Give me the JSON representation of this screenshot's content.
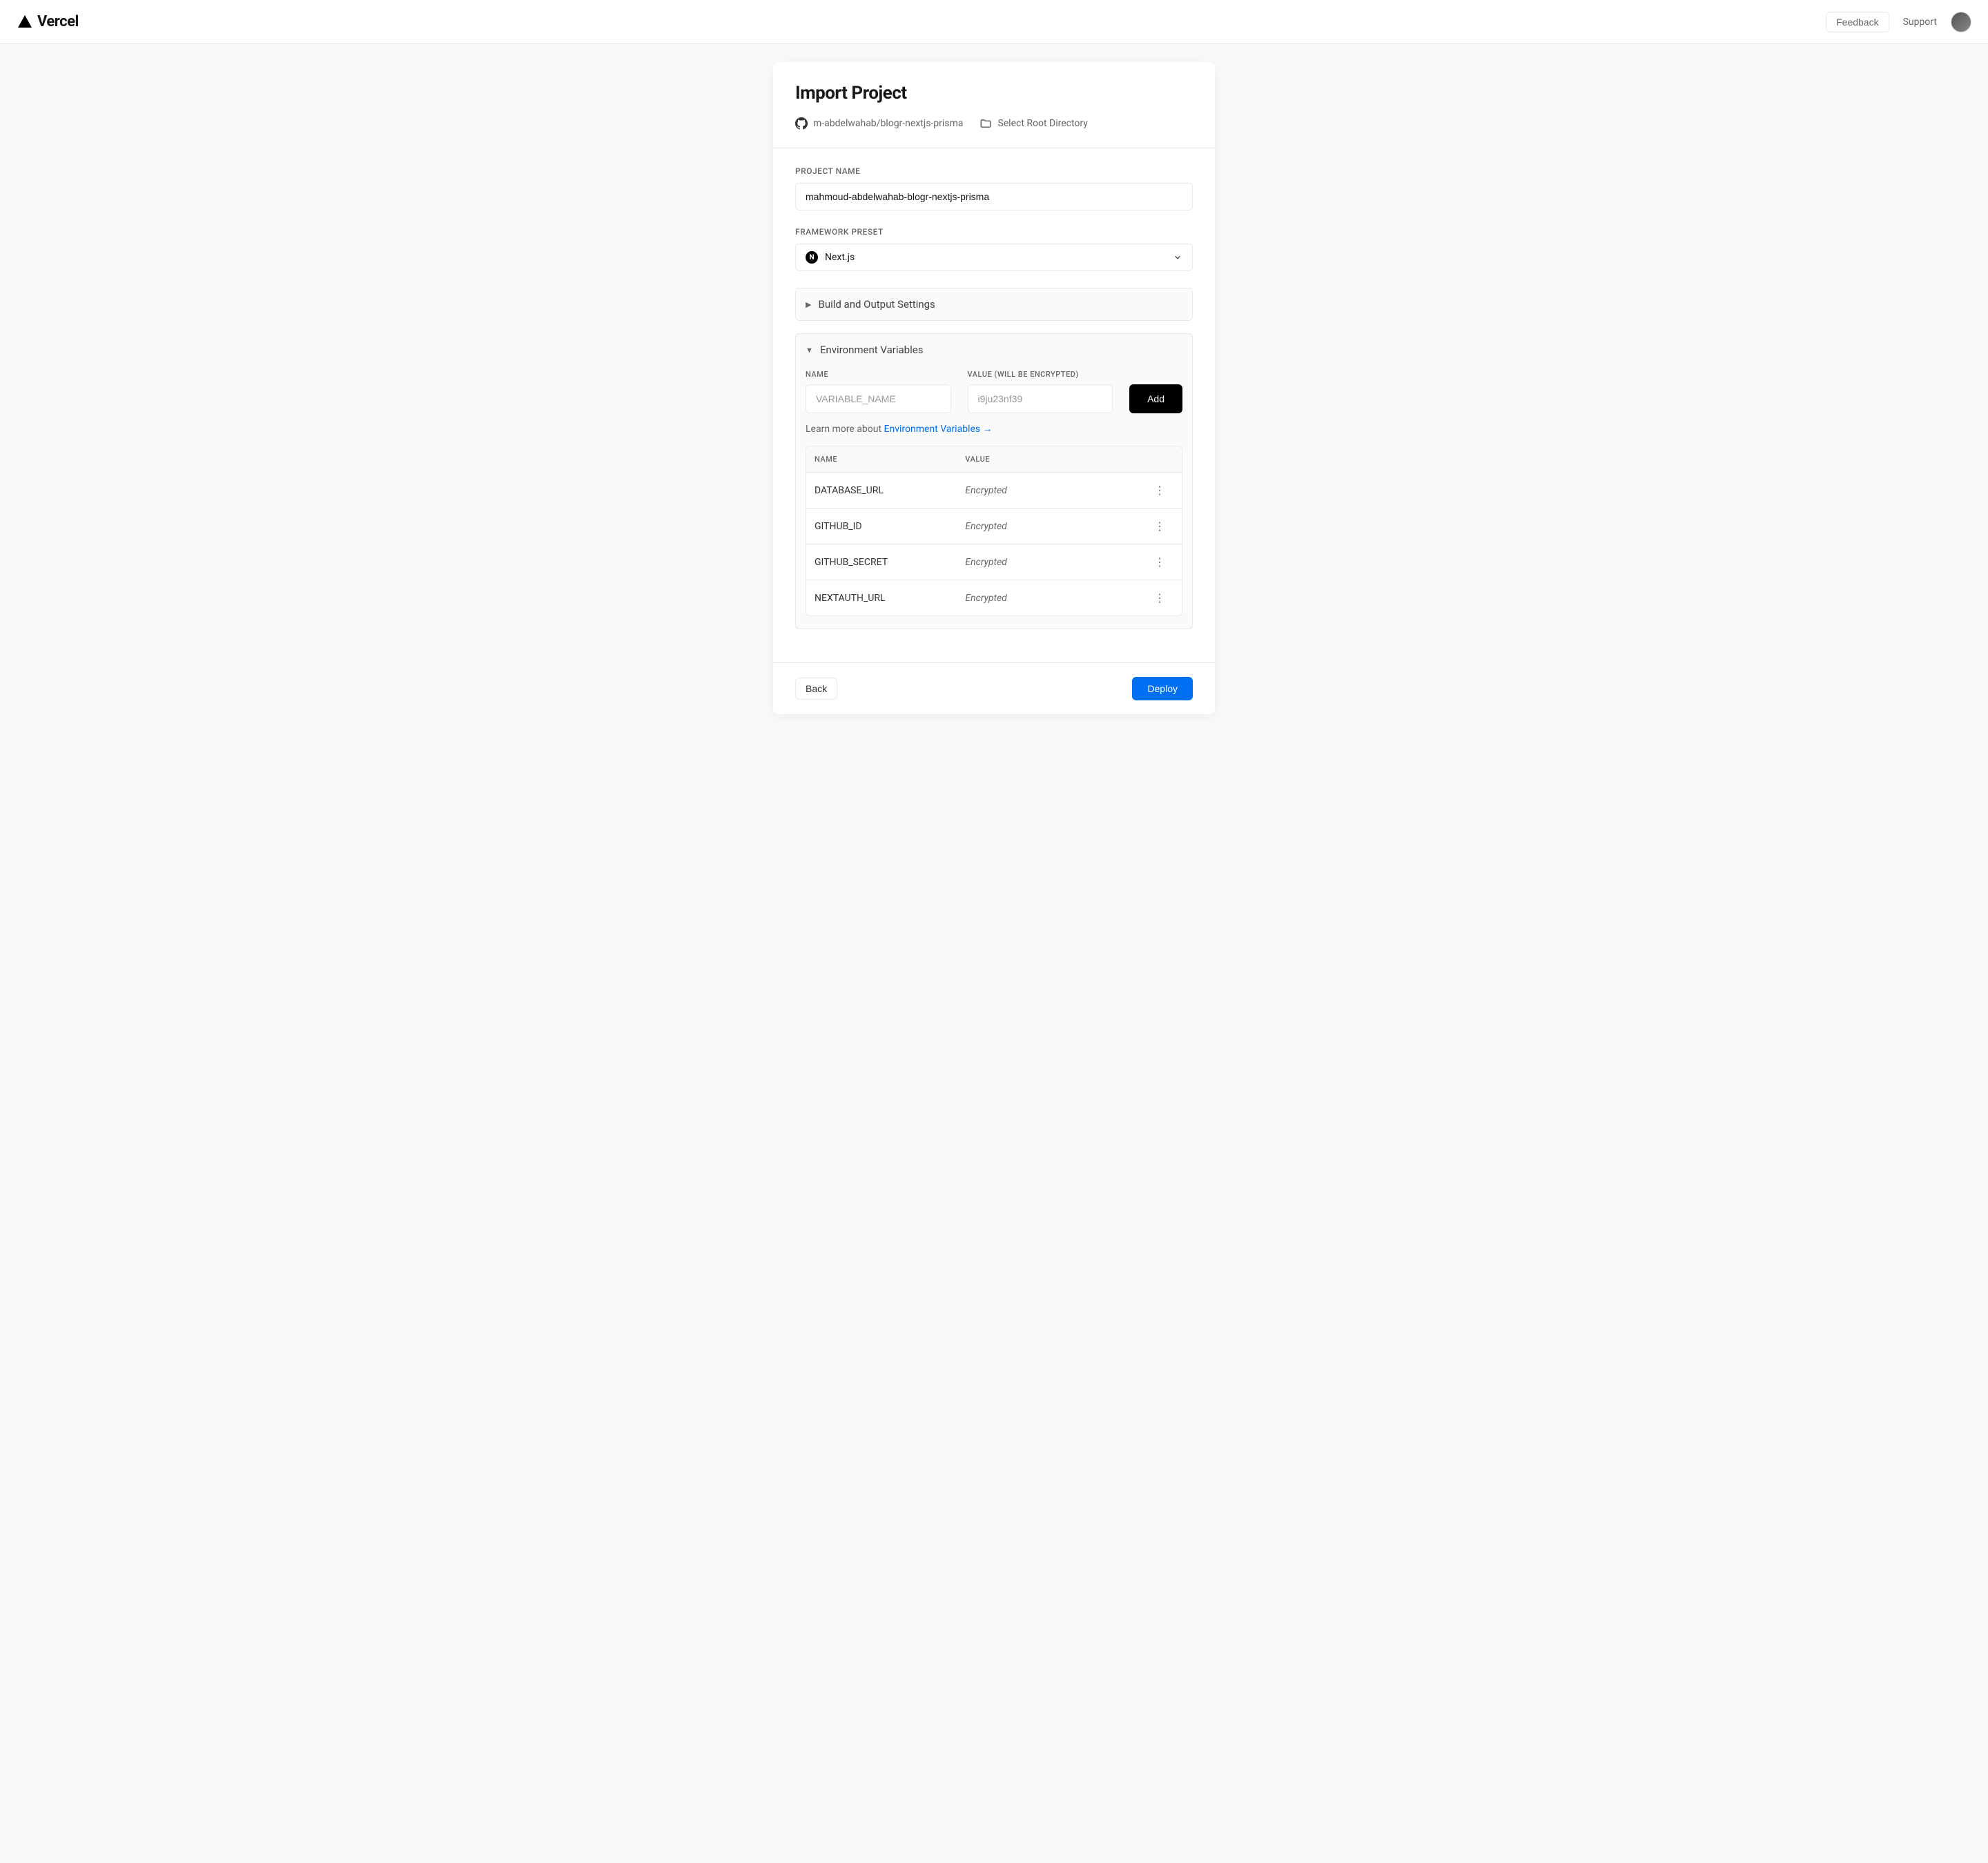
{
  "header": {
    "brand": "Vercel",
    "feedback": "Feedback",
    "support": "Support"
  },
  "page": {
    "title": "Import Project",
    "repo": "m-abdelwahab/blogr-nextjs-prisma",
    "root_dir": "Select Root Directory"
  },
  "form": {
    "project_name_label": "PROJECT NAME",
    "project_name_value": "mahmoud-abdelwahab-blogr-nextjs-prisma",
    "framework_label": "FRAMEWORK PRESET",
    "framework_value": "Next.js",
    "build_settings": "Build and Output Settings",
    "env_title": "Environment Variables",
    "env_name_label": "NAME",
    "env_value_label": "VALUE (WILL BE ENCRYPTED)",
    "env_name_placeholder": "VARIABLE_NAME",
    "env_value_placeholder": "i9ju23nf39",
    "add_button": "Add",
    "learn_prefix": "Learn more about ",
    "learn_link": "Environment Variables →",
    "table": {
      "col_name": "NAME",
      "col_value": "VALUE",
      "encrypted": "Encrypted",
      "rows": [
        {
          "name": "DATABASE_URL"
        },
        {
          "name": "GITHUB_ID"
        },
        {
          "name": "GITHUB_SECRET"
        },
        {
          "name": "NEXTAUTH_URL"
        }
      ]
    }
  },
  "footer": {
    "back": "Back",
    "deploy": "Deploy"
  }
}
